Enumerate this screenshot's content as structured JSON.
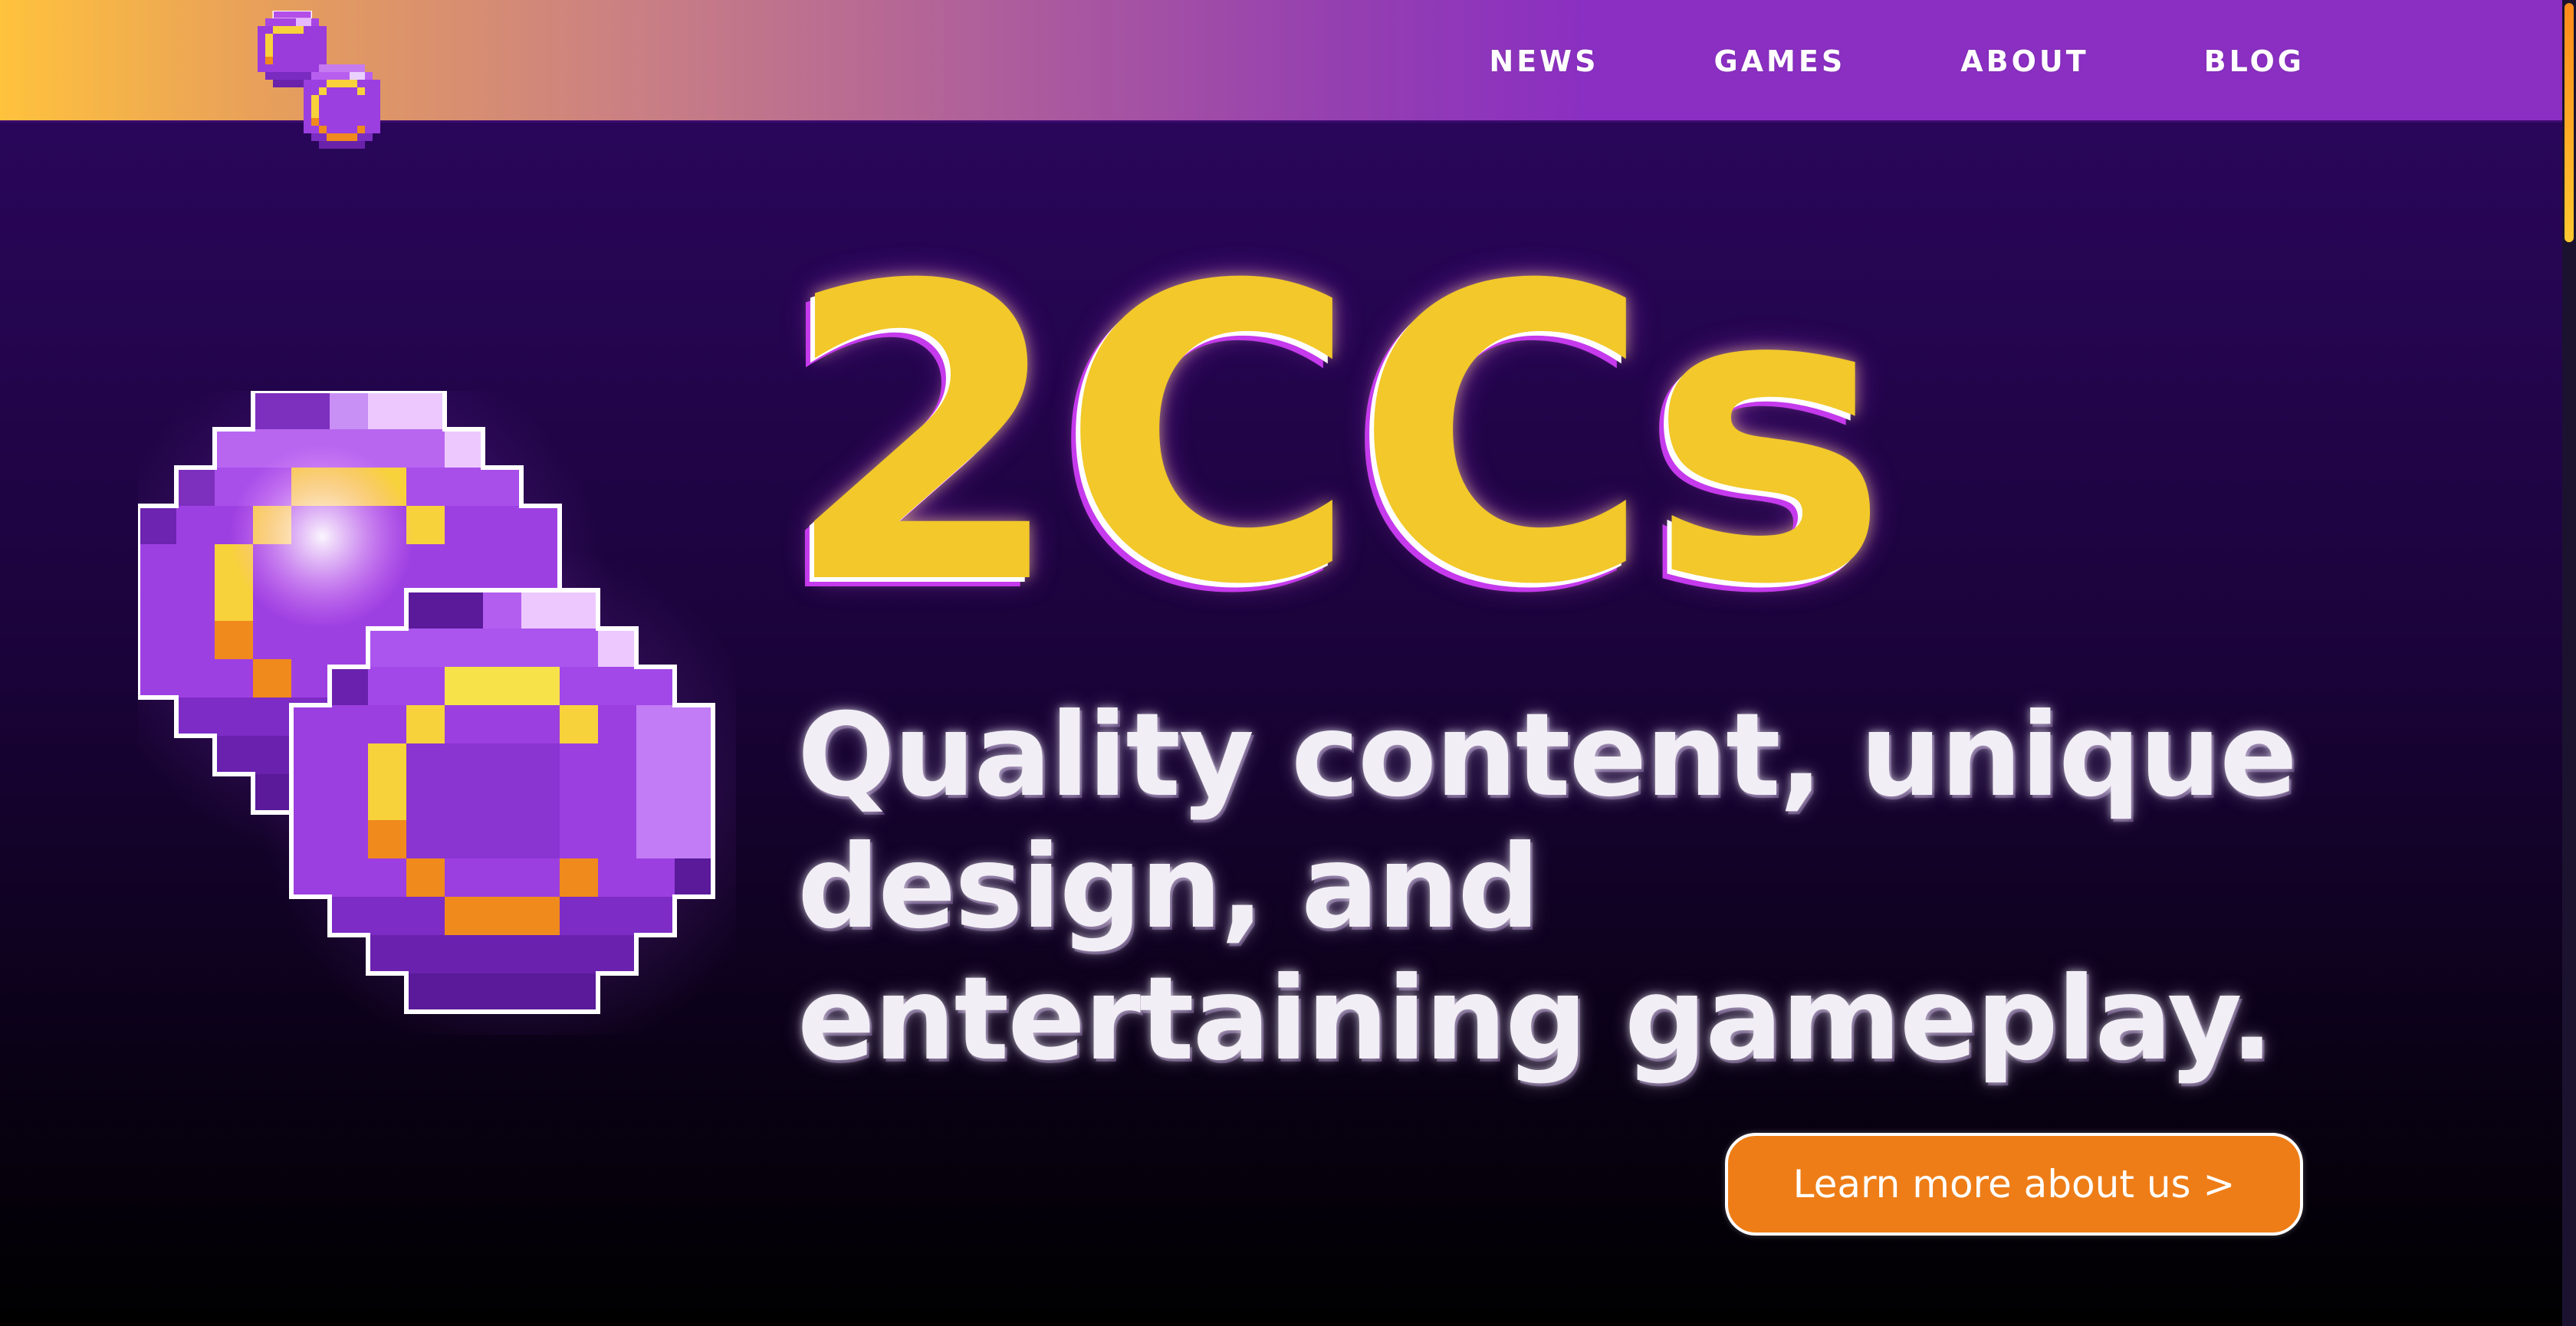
{
  "header": {
    "logo_icon": "double-gem-coin-icon",
    "nav": [
      {
        "label": "NEWS"
      },
      {
        "label": "GAMES"
      },
      {
        "label": "ABOUT"
      },
      {
        "label": "BLOG"
      }
    ]
  },
  "hero": {
    "title": "2CCs",
    "tagline": "Quality content, unique design, and entertaining gameplay.",
    "cta_label": "Learn more about us >",
    "logo_icon": "double-gem-coin-icon"
  },
  "colors": {
    "header_gradient_start": "#ffc23c",
    "header_gradient_end": "#8a2fc2",
    "background_top": "#2c0660",
    "background_bottom": "#000000",
    "title_yellow": "#f2c82a",
    "title_outline_magenta": "#c53aec",
    "cta_orange": "#ee7d17",
    "gem_purple": "#9b3fe0",
    "gem_light": "#d97cff",
    "gem_dark": "#5a1aa0",
    "gem_yellow": "#f7d23a",
    "gem_orange": "#f08a1c"
  },
  "scrollbar": {
    "position": 0.0
  }
}
